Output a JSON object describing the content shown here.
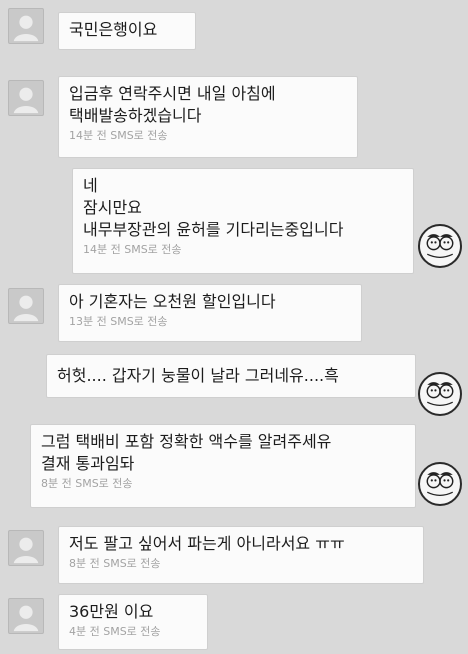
{
  "colors": {
    "background": "#d9d9d9",
    "bubble": "#fbfbfb",
    "meta_text": "#a3a3a3"
  },
  "messages": [
    {
      "side": "received",
      "lines": [
        "국민은행이요"
      ],
      "meta": ""
    },
    {
      "side": "received",
      "lines": [
        "입금후 연락주시면 내일 아침에",
        "택배발송하겠습니다"
      ],
      "meta": "14분 전 SMS로 전송"
    },
    {
      "side": "sent",
      "lines": [
        "네",
        "잠시만요",
        "내무부장관의 윤허를 기다리는중입니다"
      ],
      "meta": "14분 전 SMS로 전송"
    },
    {
      "side": "received",
      "lines": [
        "아 기혼자는 오천원 할인입니다"
      ],
      "meta": "13분 전 SMS로 전송"
    },
    {
      "side": "sent",
      "lines": [
        "허헛....  갑자기 눙물이 날라 그러네유....흑"
      ],
      "meta": ""
    },
    {
      "side": "sent",
      "lines": [
        "그럼 택배비 포함 정확한  액수를 알려주세유",
        "결재 통과임돠"
      ],
      "meta": "8분 전 SMS로 전송"
    },
    {
      "side": "received",
      "lines": [
        "저도 팔고 싶어서 파는게 아니라서요 ㅠㅠ"
      ],
      "meta": "8분 전 SMS로 전송"
    },
    {
      "side": "received",
      "lines": [
        "36만원 이요"
      ],
      "meta": "4분 전 SMS로 전송"
    }
  ],
  "icons": {
    "contact_avatar": "person-silhouette-icon",
    "my_sticker": "cartoon-couple-sticker-icon"
  }
}
